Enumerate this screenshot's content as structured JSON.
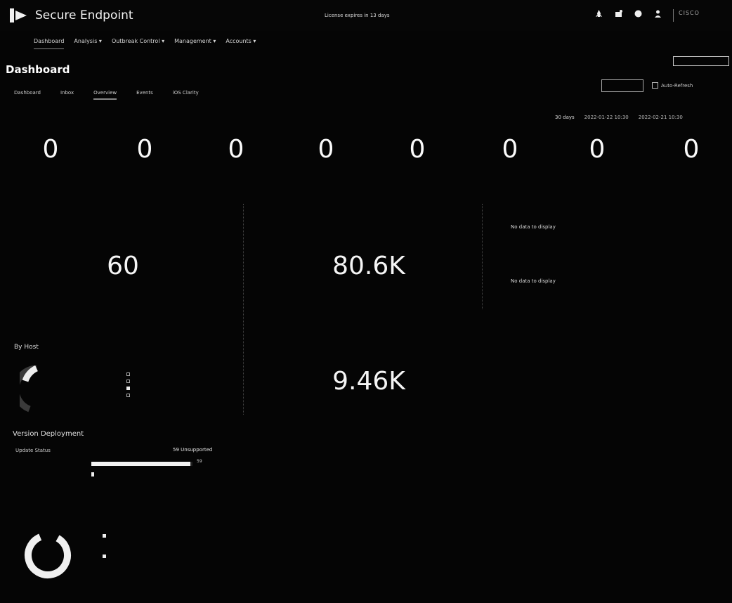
{
  "header": {
    "app_title": "Secure Endpoint",
    "license_notice": "License expires in 13 days",
    "icons": [
      "rocket-icon",
      "notifications-icon",
      "help-icon",
      "user-icon"
    ],
    "vendor": "CISCO"
  },
  "nav": {
    "items": [
      {
        "label": "Dashboard",
        "active": true
      },
      {
        "label": "Analysis ▾",
        "active": false
      },
      {
        "label": "Outbreak Control ▾",
        "active": false
      },
      {
        "label": "Management ▾",
        "active": false
      },
      {
        "label": "Accounts ▾",
        "active": false
      }
    ]
  },
  "page": {
    "title": "Dashboard"
  },
  "tabs": [
    {
      "label": "Dashboard",
      "selected": false
    },
    {
      "label": "Inbox",
      "selected": false
    },
    {
      "label": "Overview",
      "selected": true
    },
    {
      "label": "Events",
      "selected": false
    },
    {
      "label": "iOS Clarity",
      "selected": false
    }
  ],
  "toolbar": {
    "auto_refresh_label": "Auto-Refresh",
    "auto_refresh_checked": false
  },
  "range": {
    "period": "30 days",
    "start": "2022-01-22 10:30",
    "end": "2022-02-21 10:30"
  },
  "counters": [
    "0",
    "0",
    "0",
    "0",
    "0",
    "0",
    "0",
    "0"
  ],
  "panels": {
    "connectors_value": "60",
    "files_value": "80.6K",
    "second_value": "9.46K",
    "no_data_1": "No data to display",
    "no_data_2": "No data to display"
  },
  "by_host": {
    "title": "By Host"
  },
  "version_deployment": {
    "title": "Version Deployment",
    "update_status_label": "Update Status",
    "unsupported_label": "59 Unsupported",
    "bar_value": "59",
    "bar_fraction": 0.98
  },
  "colors": {
    "background": "#050505",
    "text": "#e8e8e8",
    "accent": "#f2f2f2"
  }
}
